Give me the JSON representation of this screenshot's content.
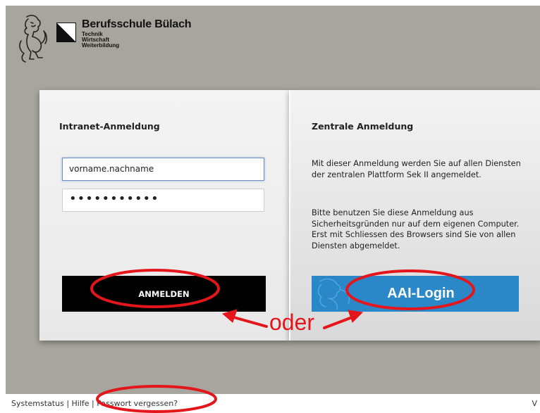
{
  "header": {
    "school_name": "Berufsschule Bülach",
    "sub_lines": [
      "Technik",
      "Wirtschaft",
      "Weiterbildung"
    ]
  },
  "intranet": {
    "title": "Intranet-Anmeldung",
    "username_value": "vorname.nachname",
    "password_mask": "•••••••••••",
    "login_button": "ANMELDEN"
  },
  "central": {
    "title": "Zentrale Anmeldung",
    "desc_1": "Mit dieser Anmeldung werden Sie auf allen Diensten der zentralen Plattform Sek II angemeldet.",
    "desc_2": "Bitte benutzen Sie diese Anmeldung aus Sicherheitsgründen nur auf dem eigenen Computer. Erst mit Schliessen des Browsers sind Sie von allen Diensten abgemeldet.",
    "aai_button": "AAI-Login"
  },
  "footer": {
    "links": [
      "Systemstatus",
      "Hilfe",
      "Passwort vergessen?"
    ],
    "separator": " | ",
    "trailing": "V"
  },
  "annotation": {
    "text": "oder",
    "color": "#e4161b"
  },
  "colors": {
    "background": "#a6a69e",
    "aai_blue": "#2a87c8",
    "button_black": "#000000"
  },
  "icons": [
    "lion-logo-icon",
    "school-mark-icon"
  ]
}
